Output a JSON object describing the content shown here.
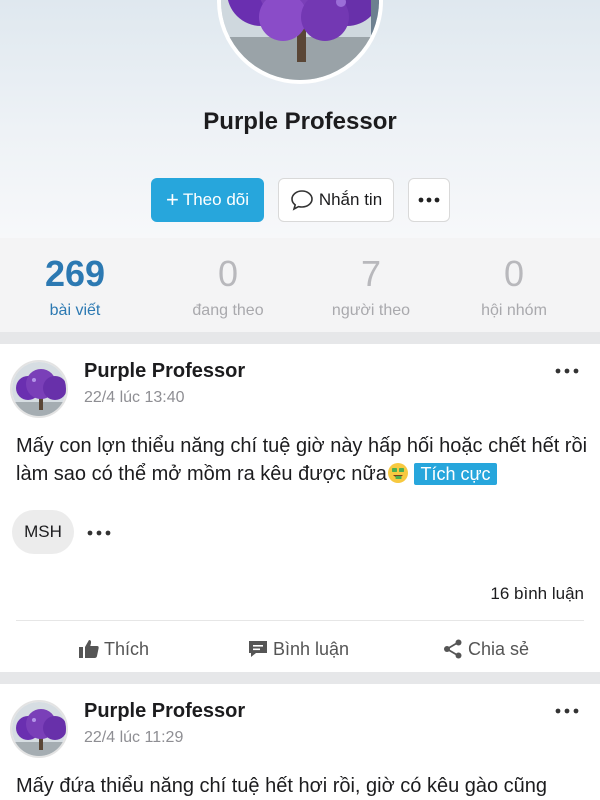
{
  "profile": {
    "name": "Purple Professor",
    "follow_label": "Theo dõi",
    "message_label": "Nhắn tin"
  },
  "stats": [
    {
      "value": "269",
      "label": "bài viết"
    },
    {
      "value": "0",
      "label": "đang theo"
    },
    {
      "value": "7",
      "label": "người theo"
    },
    {
      "value": "0",
      "label": "hội nhóm"
    }
  ],
  "posts": [
    {
      "author": "Purple Professor",
      "time": "22/4 lúc 13:40",
      "text": "Mấy con lợn thiểu năng chí tuệ giờ này hấp hối hoặc chết hết rồi làm sao có thể mở mồm ra kêu được nữa",
      "tag": "Tích cực",
      "chip": "MSH",
      "comments": "16 bình luận",
      "actions": {
        "like": "Thích",
        "comment": "Bình luận",
        "share": "Chia sẻ"
      }
    },
    {
      "author": "Purple Professor",
      "time": "22/4 lúc 11:29",
      "text": "Mấy đứa thiểu năng chí tuệ hết hơi rồi, giờ có kêu gào cũng"
    }
  ],
  "colors": {
    "accent": "#27a6dc",
    "stat_active": "#2c79b2",
    "avatar_purple": "#7a3fb8"
  },
  "icons": {
    "follow": "plus-icon",
    "message": "chat-bubble-icon",
    "more": "more-dots-icon",
    "like": "thumbs-up-icon",
    "comment": "comment-icon",
    "share": "share-icon",
    "emoji": "money-mouth-face-emoji"
  }
}
